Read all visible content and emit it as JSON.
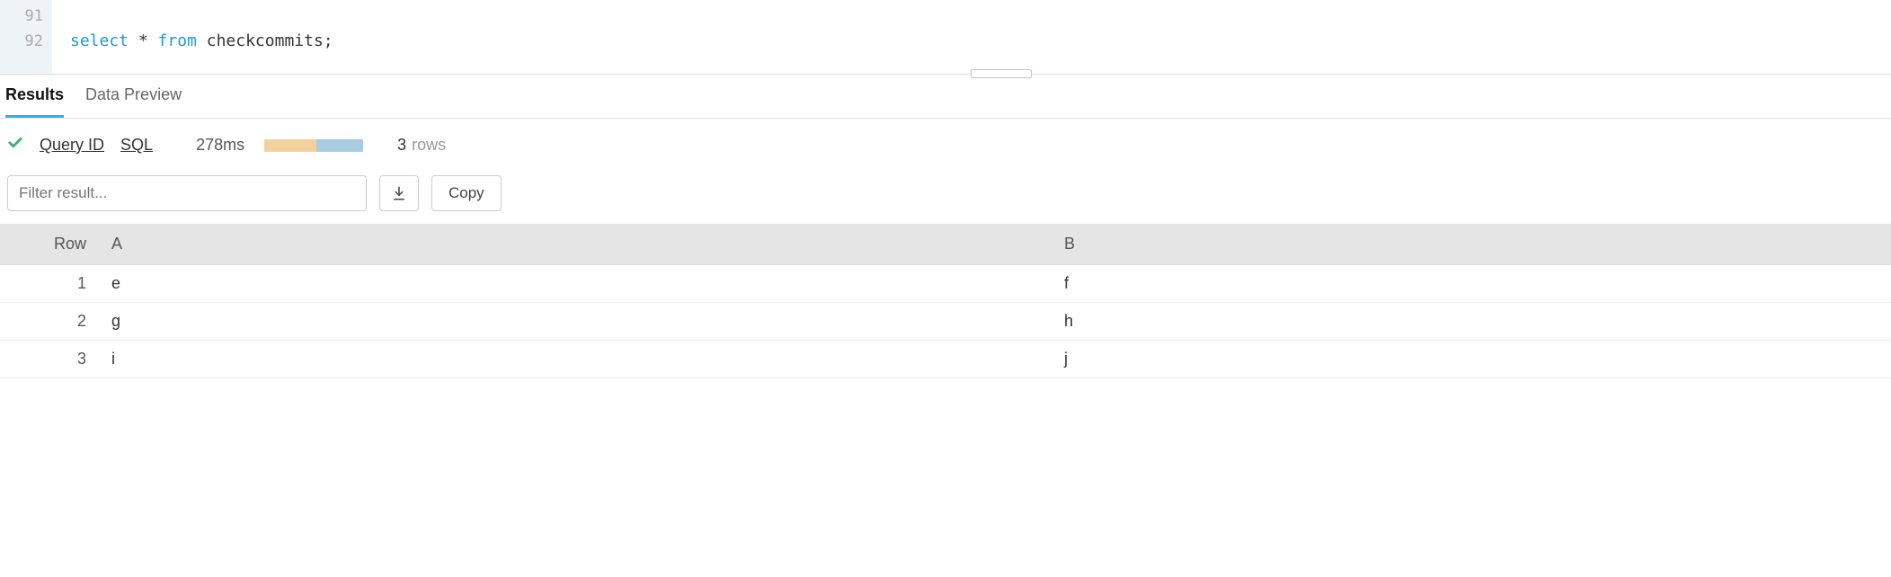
{
  "editor": {
    "lines": [
      {
        "num": "91",
        "tokens": []
      },
      {
        "num": "92",
        "tokens": [
          {
            "cls": "kw",
            "text": "select"
          },
          {
            "cls": "",
            "text": " * "
          },
          {
            "cls": "kw",
            "text": "from"
          },
          {
            "cls": "",
            "text": " checkcommits;"
          }
        ]
      }
    ]
  },
  "tabs": {
    "results": "Results",
    "data_preview": "Data Preview"
  },
  "status": {
    "query_id": "Query ID",
    "sql": "SQL",
    "duration": "278ms",
    "row_count": "3",
    "row_label": "rows"
  },
  "controls": {
    "filter_placeholder": "Filter result...",
    "copy_label": "Copy"
  },
  "table": {
    "headers": {
      "row": "Row",
      "a": "A",
      "b": "B"
    },
    "rows": [
      {
        "n": "1",
        "a": "e",
        "b": "f"
      },
      {
        "n": "2",
        "a": "g",
        "b": "h"
      },
      {
        "n": "3",
        "a": "i",
        "b": "j"
      }
    ]
  }
}
